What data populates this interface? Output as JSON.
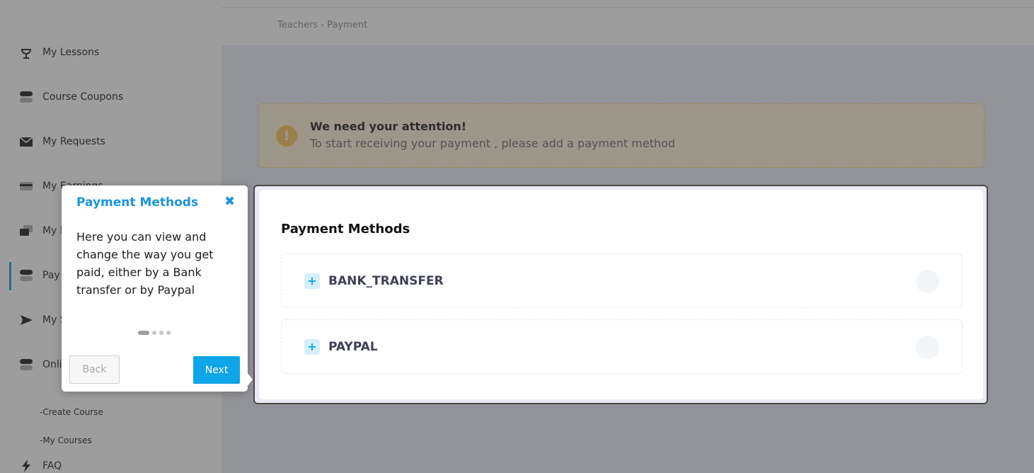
{
  "breadcrumb": "Teachers - Payment",
  "sidebar": {
    "items": [
      {
        "label": "My Lessons",
        "icon": "microphone-icon"
      },
      {
        "label": "Course Coupons",
        "icon": "toggle-icon"
      },
      {
        "label": "My Requests",
        "icon": "envelope-icon"
      },
      {
        "label": "My Earnings",
        "icon": "card-icon"
      },
      {
        "label": "My M",
        "icon": "chat-icon"
      },
      {
        "label": "Pay",
        "icon": "toggle-icon"
      },
      {
        "label": "My S",
        "icon": "send-icon"
      },
      {
        "label": "Onli",
        "icon": "toggle-icon"
      },
      {
        "label": "FAQ",
        "icon": "bolt-icon"
      }
    ],
    "sub_items": [
      "-Create Course",
      "-My Courses"
    ]
  },
  "alert": {
    "title": "We need your attention!",
    "text": "To start receiving your payment , please add a payment method",
    "icon": "exclamation-icon"
  },
  "payment_methods": {
    "title": "Payment Methods",
    "methods": [
      "BANK_TRANSFER",
      "PAYPAL"
    ]
  },
  "tour": {
    "title": "Payment Methods",
    "close_glyph": "✖",
    "body": "Here you can view and change the way you get paid, either by a Bank transfer or by Paypal",
    "back_label": "Back",
    "next_label": "Next",
    "step_count": 4,
    "active_step": 1
  },
  "colors": {
    "accent": "#0ea5e9",
    "tour_title": "#1b95e0",
    "alert_bg": "#fff3d6",
    "main_bg": "#e9eaf4"
  }
}
